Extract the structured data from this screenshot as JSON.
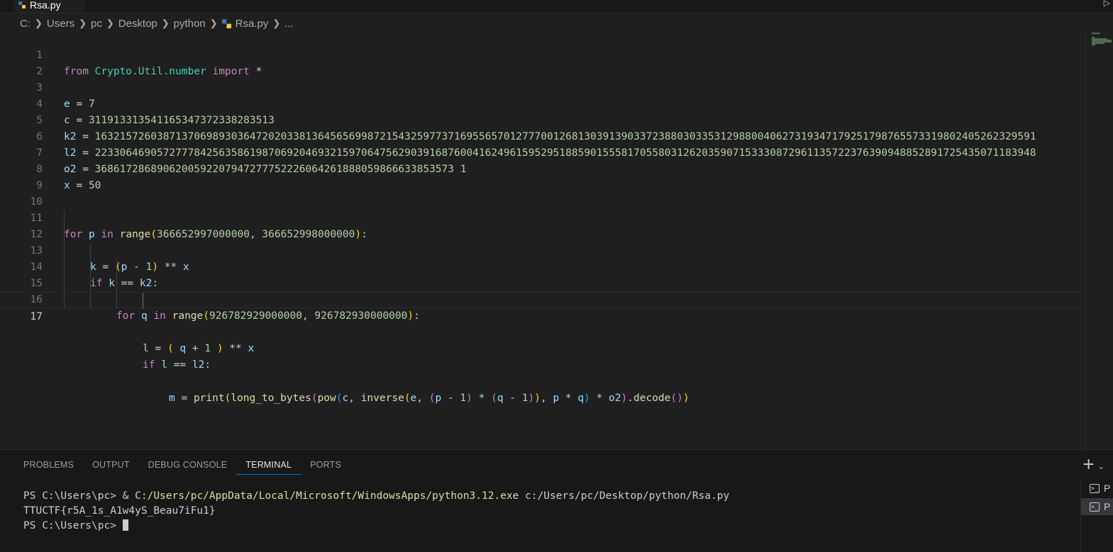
{
  "editor": {
    "tab_label": "Rsa.py",
    "breadcrumb": [
      "C:",
      "Users",
      "pc",
      "Desktop",
      "python",
      "Rsa.py",
      "..."
    ],
    "active_line": 17,
    "line_numbers": [
      "1",
      "2",
      "3",
      "4",
      "5",
      "6",
      "7",
      "8",
      "9",
      "10",
      "11",
      "12",
      "13",
      "14",
      "15",
      "16",
      "17"
    ],
    "lines": {
      "l1": {
        "kw1": "from",
        "mod": "Crypto.Util.number",
        "kw2": "import",
        "star": "*"
      },
      "l3": {
        "var": "e",
        "eq": "=",
        "val": "7"
      },
      "l4": {
        "var": "c",
        "eq": "=",
        "val": "311913313541165347372338283513"
      },
      "l5": {
        "var": "k2",
        "eq": "=",
        "val": "16321572603871370698930364720203381364565699872154325977371695565701277700126813039139033723880303353129880040627319347179251798765573319802405262329591"
      },
      "l6": {
        "var": "l2",
        "eq": "=",
        "val": "22330646905727778425635861987069204693215970647562903916876004162496159529518859015558170558031262035907153330872961135722376390948852891725435071183948"
      },
      "l7": {
        "var": "o2",
        "eq": "=",
        "val": "3686172868906200592207947277752226064261888059866633853573 1"
      },
      "l8": {
        "var": "x",
        "eq": "=",
        "val": "50"
      },
      "l11": {
        "kw": "for",
        "v1": "p",
        "kin": "in",
        "fn": "range",
        "a1": "366652997000000",
        "a2": "366652998000000"
      },
      "l12": {
        "v1": "k",
        "v2": "p",
        "n1": "1",
        "v3": "x"
      },
      "l13": {
        "kw": "if",
        "v1": "k",
        "v2": "k2"
      },
      "l14": {
        "kw": "for",
        "v1": "q",
        "kin": "in",
        "fn": "range",
        "a1": "926782929000000",
        "a2": "926782930000000"
      },
      "l15": {
        "v1": "l",
        "v2": "q",
        "n1": "1",
        "v3": "x"
      },
      "l16": {
        "kw": "if",
        "v1": "l",
        "v2": "l2"
      },
      "l17": {
        "v1": "m",
        "fn1": "print",
        "fn2": "long_to_bytes",
        "fn3": "pow",
        "vc": "c",
        "fn4": "inverse",
        "ve": "e",
        "vp": "p",
        "n1": "1",
        "vq": "q",
        "n2": "1",
        "vp2": "p",
        "vq2": "q",
        "vo": "o2",
        "fn5": "decode"
      }
    }
  },
  "panel": {
    "tabs": [
      "PROBLEMS",
      "OUTPUT",
      "DEBUG CONSOLE",
      "TERMINAL",
      "PORTS"
    ],
    "active_tab": "TERMINAL",
    "terminal": {
      "prompt1": "PS C:\\Users\\pc> & ",
      "exe": "C:/Users/pc/AppData/Local/Microsoft/WindowsApps/python3.12.exe",
      "script": " c:/Users/pc/Desktop/python/Rsa.py",
      "output": "TTUCTF{r5A_1s_A1w4yS_Beau7iFu1}",
      "prompt2": "PS C:\\Users\\pc> "
    },
    "terminal_list": [
      "P",
      "P"
    ],
    "add_icon": "plus-icon"
  }
}
